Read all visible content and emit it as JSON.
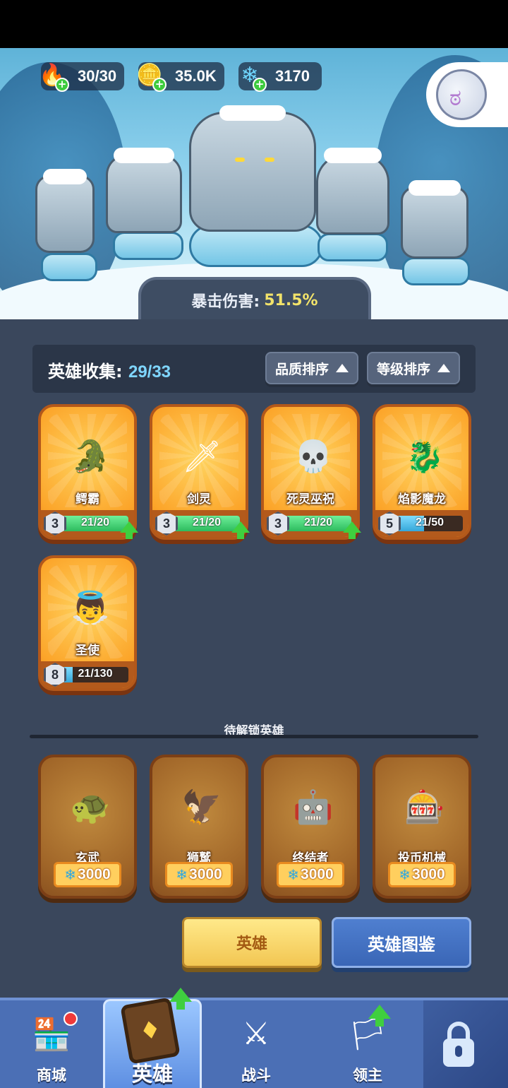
{
  "resources": {
    "stamina": {
      "value": "30/30",
      "icon": "flame-icon"
    },
    "gold": {
      "value": "35.0K",
      "icon": "gold-coin-icon"
    },
    "crystal": {
      "value": "3170",
      "icon": "ice-crystal-icon"
    }
  },
  "banner": {
    "crit_label": "暴击伤害:",
    "crit_value": "51.5%"
  },
  "collection": {
    "label": "英雄收集:",
    "count": "29/33",
    "sort_quality": "品质排序",
    "sort_level": "等级排序"
  },
  "heroes": [
    {
      "name": "鳄霸",
      "level": "3",
      "progress": "21/20",
      "fill": 1.0,
      "upgradable": true,
      "emoji": "🐊"
    },
    {
      "name": "剑灵",
      "level": "3",
      "progress": "21/20",
      "fill": 1.0,
      "upgradable": true,
      "emoji": "🗡"
    },
    {
      "name": "死灵巫祝",
      "level": "3",
      "progress": "21/20",
      "fill": 1.0,
      "upgradable": true,
      "emoji": "💀"
    },
    {
      "name": "焰影魔龙",
      "level": "5",
      "progress": "21/50",
      "fill": 0.42,
      "upgradable": false,
      "emoji": "🐉"
    },
    {
      "name": "圣使",
      "level": "8",
      "progress": "21/130",
      "fill": 0.16,
      "upgradable": false,
      "emoji": "👼"
    }
  ],
  "locked_section_title": "待解锁英雄",
  "locked_heroes": [
    {
      "name": "玄武",
      "price": "3000",
      "emoji": "🐢"
    },
    {
      "name": "狮鹫",
      "price": "3000",
      "emoji": "🦅"
    },
    {
      "name": "终结者",
      "price": "3000",
      "emoji": "🤖"
    },
    {
      "name": "投币机械",
      "price": "3000",
      "emoji": "🎰"
    }
  ],
  "actions": {
    "hero": "英雄",
    "codex": "英雄图鉴"
  },
  "nav": {
    "shop": "商城",
    "hero": "英雄",
    "battle": "战斗",
    "lord": "领主"
  }
}
